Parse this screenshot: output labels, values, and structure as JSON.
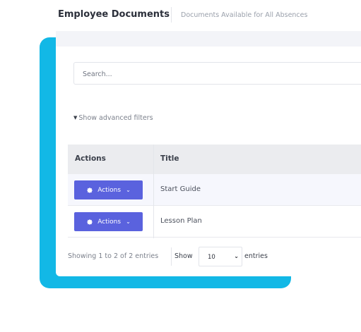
{
  "header": {
    "title": "Employee Documents",
    "subtitle": "Documents Available for All Absences"
  },
  "search": {
    "placeholder": "Search..."
  },
  "filters": {
    "toggle_label": "Show advanced filters"
  },
  "table": {
    "columns": [
      "Actions",
      "Title"
    ],
    "rows": [
      {
        "action_label": "Actions",
        "title": "Start Guide"
      },
      {
        "action_label": "Actions",
        "title": "Lesson Plan"
      }
    ]
  },
  "footer": {
    "showing_text": "Showing 1 to 2 of 2 entries",
    "show_label": "Show",
    "page_size": "10",
    "entries_label": "entries"
  },
  "colors": {
    "accent_card": "#12b8e6",
    "action_button": "#5a62de",
    "table_header_bg": "#ebecef"
  },
  "icons": {
    "action_button": "gear-icon",
    "action_dropdown": "chevron-down-icon",
    "filters_toggle": "chevron-down-icon"
  }
}
